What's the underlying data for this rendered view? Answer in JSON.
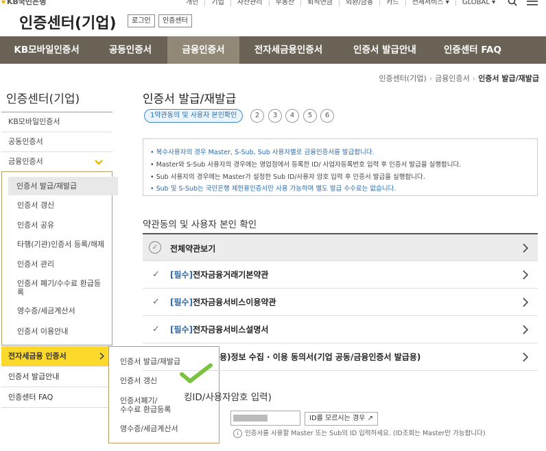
{
  "header": {
    "logo_star": "★",
    "logo_text": "KB국민은행",
    "top_links": [
      "개인",
      "기업",
      "자산관리",
      "부동산",
      "퇴직연금",
      "외환/금융",
      "카드",
      "전체서비스 ▾",
      "GLOBAL ▾"
    ],
    "site_title": "인증센터(기업)",
    "login_label": "로그인",
    "cert_center_label": "인증센터"
  },
  "gnb": {
    "items": [
      "KB모바일인증서",
      "공동인증서",
      "금융인증서",
      "전자세금용인증서",
      "인증서 발급안내",
      "인증센터 FAQ"
    ]
  },
  "breadcrumb": [
    "인증센터(기업)",
    "금융인증서",
    "인증서 발급/재발급"
  ],
  "sidebar": {
    "title": "인증센터(기업)",
    "items": [
      "KB모바일인증서",
      "공동인증서",
      "금융인증서"
    ],
    "sub_items": [
      "인증서 발급/재발급",
      "인증서 갱신",
      "인증서 공유",
      "타행(기관)인증서 등록/해제",
      "인증서 관리",
      "인증서 폐기/수수료 환급등록",
      "영수증/세금계산서",
      "인증서 이용안내"
    ],
    "bottom_items": [
      "전자세금용 인증서",
      "인증서 발급안내",
      "인증센터 FAQ"
    ]
  },
  "flyout": {
    "items": [
      "인증서 발급/재발급",
      "인증서 갱신",
      "인증서폐기/\n수수료 환급등록",
      "영수증/세금계산서"
    ]
  },
  "main": {
    "title": "인증서 발급/재발급",
    "step_first": "1약관동의 및 사용자 본인확인",
    "steps": [
      "2",
      "3",
      "4",
      "5",
      "6"
    ],
    "notices": [
      "• 복수사용자의 경우 Master, S-Sub, Sub 사용자별로 금융인증서를 발급합니다.",
      "• Master와 S-Sub 사용자의 경우에는 영업점에서 등록한 ID/ 사업자등록번호 입력 후 인증서 발급을 실행합니다.",
      "• Sub 사용자의 경우에는 Master가 설정한 Sub ID/사용자 암호 입력 후 인증서 발급을 실행합니다.",
      "• Sub 및 S-Sub는 국민은행 제한용인증서만 사용 가능하며 별도 발급 수수료는 없습니다."
    ],
    "section_terms": "약관동의 및 사용자 본인 확인",
    "terms_all": "전체약관보기",
    "terms": [
      {
        "req": "[필수]",
        "label": "전자금융거래기본약관"
      },
      {
        "req": "[필수]",
        "label": "전자금융서비스이용약관"
      },
      {
        "req": "[필수]",
        "label": "전자금융서비스설명서"
      },
      {
        "req": "",
        "label": "용)정보 수집 · 이용 동의서(기업 공동/금융인증서 발급용)"
      }
    ],
    "section_id": "킹ID/사용자암호 입력)",
    "id_button": "ID를 모르시는 경우 ↗",
    "hint_icon": "i",
    "hint": "인증서를 사용할 Master 또는 Sub의 ID 입력하세요. (ID조회는 Master만 가능합니다)"
  },
  "icons": {
    "search": "search-icon",
    "menu": "hamburger-icon",
    "chevron_down": "chevron-down-icon",
    "chevron_right": "chevron-right-icon",
    "check": "check-icon"
  },
  "colors": {
    "gnb": "#6b6256",
    "gnb_active": "#918878",
    "highlight": "#fdd92c",
    "accent_blue": "#2b6cb0",
    "checkmark": "#7cc242"
  }
}
